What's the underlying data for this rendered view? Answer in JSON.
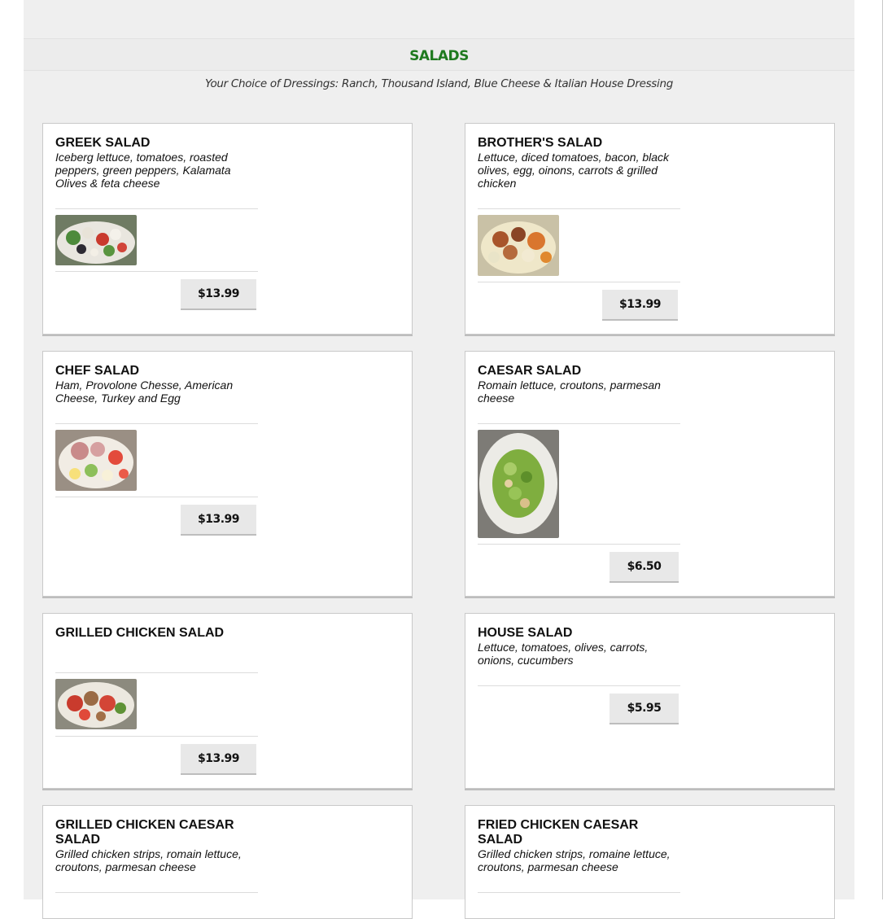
{
  "section": {
    "title": "SALADS",
    "subtitle": "Your Choice of Dressings: Ranch, Thousand Island, Blue Cheese & Italian House Dressing"
  },
  "items": [
    {
      "name": "GREEK SALAD",
      "desc": "Iceberg lettuce, tomatoes, roasted peppers, green peppers, Kalamata Olives & feta cheese",
      "price": "$13.99",
      "image": "greek-salad-photo"
    },
    {
      "name": "BROTHER'S SALAD",
      "desc": "Lettuce, diced tomatoes, bacon, black olives, egg, oinons, carrots & grilled chicken",
      "price": "$13.99",
      "image": "brothers-salad-photo"
    },
    {
      "name": "CHEF SALAD",
      "desc": "Ham, Provolone Chesse, American Cheese, Turkey and Egg",
      "price": "$13.99",
      "image": "chef-salad-photo"
    },
    {
      "name": "CAESAR SALAD",
      "desc": "Romain lettuce, croutons, parmesan cheese",
      "price": "$6.50",
      "image": "caesar-salad-photo"
    },
    {
      "name": "GRILLED CHICKEN SALAD",
      "desc": "",
      "price": "$13.99",
      "image": "grilled-chicken-salad-photo"
    },
    {
      "name": "HOUSE SALAD",
      "desc": "Lettuce, tomatoes, olives, carrots, onions, cucumbers",
      "price": "$5.95"
    },
    {
      "name": "GRILLED CHICKEN CAESAR SALAD",
      "desc": "Grilled chicken strips, romain lettuce, croutons, parmesan cheese"
    },
    {
      "name": "FRIED CHICKEN CAESAR SALAD",
      "desc": "Grilled chicken strips, romaine lettuce, croutons, parmesan cheese"
    }
  ]
}
